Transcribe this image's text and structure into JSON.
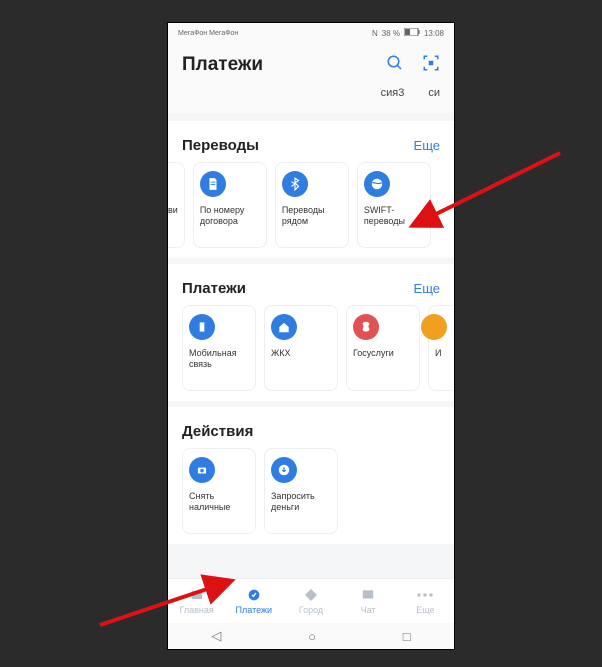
{
  "status": {
    "carrier": "МегаФон\nМегаФон",
    "nfc": "N",
    "battery_pct": "38 %",
    "time": "13:08"
  },
  "header": {
    "title": "Платежи"
  },
  "chips": {
    "c1": "сия3",
    "c2": "си"
  },
  "sections": {
    "transfers": {
      "title": "Переводы",
      "more": "Еще",
      "items": {
        "stub_left": "ви",
        "by_contract": "По номеру договора",
        "nearby": "Переводы рядом",
        "swift": "SWIFT-переводы"
      }
    },
    "payments": {
      "title": "Платежи",
      "more": "Еще",
      "items": {
        "mobile": "Мобильная связь",
        "jkh": "ЖКХ",
        "gos": "Госуслуги",
        "stub_right": "И"
      }
    },
    "actions": {
      "title": "Действия",
      "items": {
        "withdraw": "Снять наличные",
        "request": "Запросить деньги"
      }
    }
  },
  "nav": {
    "home": "Главная",
    "payments": "Платежи",
    "city": "Город",
    "chat": "Чат",
    "more": "Еще"
  }
}
